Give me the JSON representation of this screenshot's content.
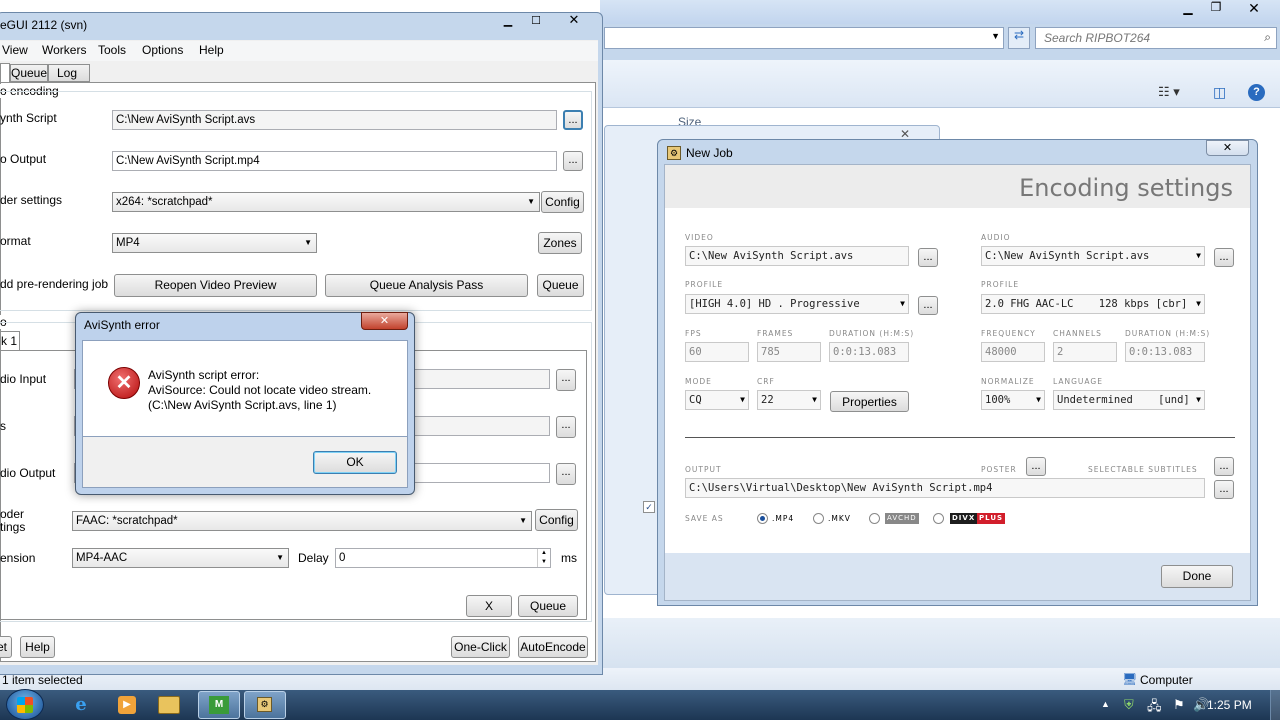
{
  "explorer": {
    "title": "RIPBOT264",
    "search_placeholder": "Search RIPBOT264",
    "column_size": "Size",
    "status_selected": "1 item selected",
    "computer_label": "Computer"
  },
  "megui": {
    "title": "eGUI 2112 (svn)",
    "menu": [
      "View",
      "Workers",
      "Tools",
      "Options",
      "Help"
    ],
    "tabs": [
      "Queue",
      "Log"
    ],
    "group_encoding": "o encoding",
    "label_script": "ynth Script",
    "script_value": "C:\\New AviSynth Script.avs",
    "label_output": "o Output",
    "output_value": "C:\\New AviSynth Script.mp4",
    "label_encoder": "der settings",
    "encoder_value": "x264: *scratchpad*",
    "config_label": "Config",
    "label_format": "ormat",
    "format_value": "MP4",
    "zones_label": "Zones",
    "label_prerender": "dd pre-rendering job",
    "reopen_preview": "Reopen Video Preview",
    "queue_analysis": "Queue Analysis Pass",
    "queue_label": "Queue",
    "group_audio": "o",
    "audio_tab": "k 1",
    "label_audio_input": "dio Input",
    "label_s": "s",
    "label_audio_output": "dio Output",
    "label_audio_encoder_1": "oder",
    "label_audio_encoder_2": "tings",
    "audio_encoder_value": "FAAC: *scratchpad*",
    "audio_config_label": "Config",
    "label_extension": "ension",
    "extension_value": "MP4-AAC",
    "delay_label": "Delay",
    "delay_value": "0",
    "ms_label": "ms",
    "x_label": "X",
    "queue2_label": "Queue",
    "bottom_left": "et",
    "help_label": "Help",
    "one_click": "One-Click",
    "auto_encode": "AutoEncode",
    "dots": "..."
  },
  "error_dialog": {
    "title": "AviSynth error",
    "line1": "AviSynth script error:",
    "line2": "AviSource: Could not locate video stream.",
    "line3": "(C:\\New AviSynth Script.avs, line 1)",
    "ok_label": "OK"
  },
  "new_job": {
    "title": "New Job",
    "header": "Encoding settings",
    "video_cap": "VIDEO",
    "video_value": "C:\\New AviSynth Script.avs",
    "audio_cap": "AUDIO",
    "audio_value": "C:\\New AviSynth Script.avs",
    "profile_cap": "PROFILE",
    "video_profile": "[HIGH 4.0] HD . Progressive",
    "audio_profile": "2.0 FHG AAC-LC    128 kbps [cbr]",
    "fps_cap": "FPS",
    "fps_value": "60",
    "frames_cap": "FRAMES",
    "frames_value": "785",
    "duration_cap": "DURATION (H:M:S)",
    "duration_value": "0:0:13.083",
    "frequency_cap": "FREQUENCY",
    "frequency_value": "48000",
    "channels_cap": "CHANNELS",
    "channels_value": "2",
    "audio_duration_value": "0:0:13.083",
    "mode_cap": "MODE",
    "mode_value": "CQ",
    "crf_cap": "CRF",
    "crf_value": "22",
    "properties_label": "Properties",
    "normalize_cap": "NORMALIZE",
    "normalize_value": "100%",
    "language_cap": "LANGUAGE",
    "language_value": "Undetermined    [und]",
    "output_cap": "OUTPUT",
    "poster_cap": "POSTER",
    "subtitles_cap": "SELECTABLE SUBTITLES",
    "output_value": "C:\\Users\\Virtual\\Desktop\\New AviSynth Script.mp4",
    "save_as_cap": "SAVE AS",
    "opt_mp4": ".MP4",
    "opt_mkv": ".MKV",
    "opt_avchd": "AVCHD",
    "opt_divx": "DIVX",
    "opt_divx_plus": "PLUS",
    "done_label": "Done"
  },
  "taskbar": {
    "time": "1:25 PM"
  }
}
